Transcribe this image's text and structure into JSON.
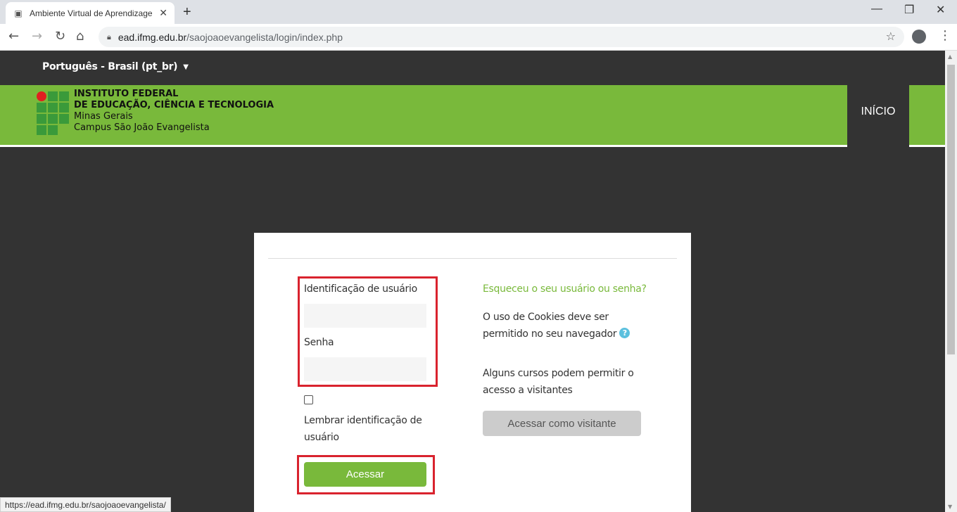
{
  "browser": {
    "tab_title": "Ambiente Virtual de Aprendizage",
    "close_glyph": "✕",
    "new_tab_glyph": "+",
    "url_host": "ead.ifmg.edu.br",
    "url_path": "/saojoaoevangelista/login/index.php",
    "status_url": "https://ead.ifmg.edu.br/saojoaoevangelista/",
    "minimize_glyph": "—",
    "restore_glyph": "❐",
    "win_close_glyph": "✕"
  },
  "header": {
    "language": "Português - Brasil (pt_br)",
    "logo_line1": "INSTITUTO FEDERAL",
    "logo_line2": "DE EDUCAÇÃO, CIÊNCIA E TECNOLOGIA",
    "logo_line3": "Minas Gerais",
    "logo_line4": "Campus São João Evangelista",
    "nav_home": "INÍCIO"
  },
  "login": {
    "username_label": "Identificação de usuário",
    "username_value": "",
    "password_label": "Senha",
    "password_value": "",
    "remember_label": "Lembrar identificação de usuário",
    "remember_checked": false,
    "submit_label": "Acessar",
    "forgot_link": "Esqueceu o seu usuário ou senha?",
    "cookies_text": "O uso de Cookies deve ser permitido no seu navegador",
    "guests_text": "Alguns cursos podem permitir o acesso a visitantes",
    "guest_button": "Acessar como visitante"
  },
  "colors": {
    "brand_green": "#79b93b",
    "dark_bg": "#333333",
    "highlight_red": "#d9232e",
    "help_blue": "#5bc0de"
  }
}
